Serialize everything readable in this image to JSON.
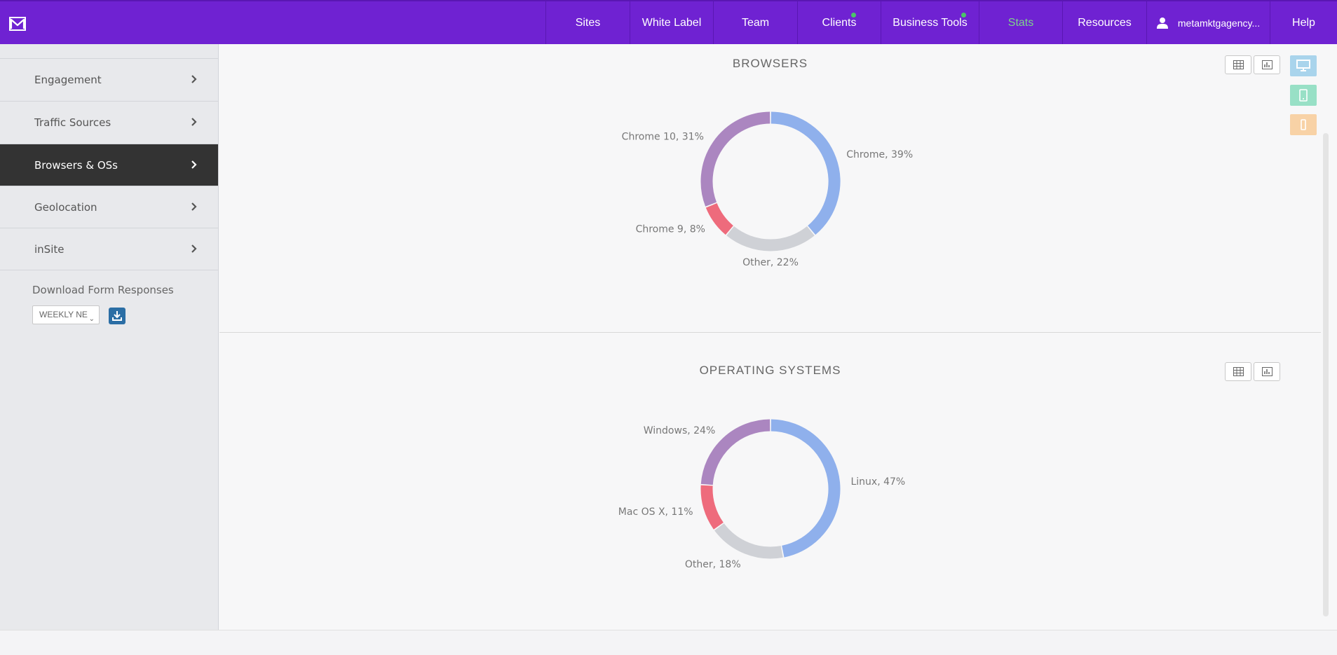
{
  "nav": {
    "items": [
      "Sites",
      "White Label",
      "Team",
      "Clients",
      "Business Tools",
      "Stats",
      "Resources"
    ],
    "user": "metamktgagency...",
    "help": "Help",
    "active": "Stats",
    "dot_color": "#4cc36a"
  },
  "sidebar": {
    "items": [
      "Engagement",
      "Traffic Sources",
      "Browsers & OSs",
      "Geolocation",
      "inSite"
    ],
    "active": "Browsers & OSs",
    "download_label": "Download Form Responses",
    "download_select": "WEEKLY NE"
  },
  "browsers": {
    "title": "BROWSERS"
  },
  "os": {
    "title": "OPERATING  SYSTEMS"
  },
  "chart_data": [
    {
      "type": "pie",
      "title": "BROWSERS",
      "categories": [
        "Chrome",
        "Other",
        "Chrome 9",
        "Chrome 10"
      ],
      "values": [
        39,
        22,
        8,
        31
      ],
      "labels": [
        "Chrome, 39%",
        "Other, 22%",
        "Chrome 9, 8%",
        "Chrome 10, 31%"
      ],
      "colors": [
        "#8fb0ec",
        "#cfd1d6",
        "#ee6b7c",
        "#ab86c0"
      ]
    },
    {
      "type": "pie",
      "title": "OPERATING  SYSTEMS",
      "categories": [
        "Linux",
        "Other",
        "Mac OS X",
        "Windows"
      ],
      "values": [
        47,
        18,
        11,
        24
      ],
      "labels": [
        "Linux, 47%",
        "Other, 18%",
        "Mac OS X, 11%",
        "Windows, 24%"
      ],
      "colors": [
        "#8fb0ec",
        "#cfd1d6",
        "#ee6b7c",
        "#ab86c0"
      ]
    }
  ],
  "colors": {
    "topbar": "#6f22d2",
    "sidebar_active": "#333333",
    "download_button": "#2b6ea5",
    "desktop": "#a9d4ec",
    "tablet": "#98e0c6",
    "mobile": "#f8d2a6"
  },
  "icons": [
    "logo-icon",
    "user-icon",
    "chevron-right-icon",
    "download-icon",
    "table-icon",
    "bar-chart-icon",
    "desktop-icon",
    "tablet-icon",
    "mobile-icon"
  ]
}
